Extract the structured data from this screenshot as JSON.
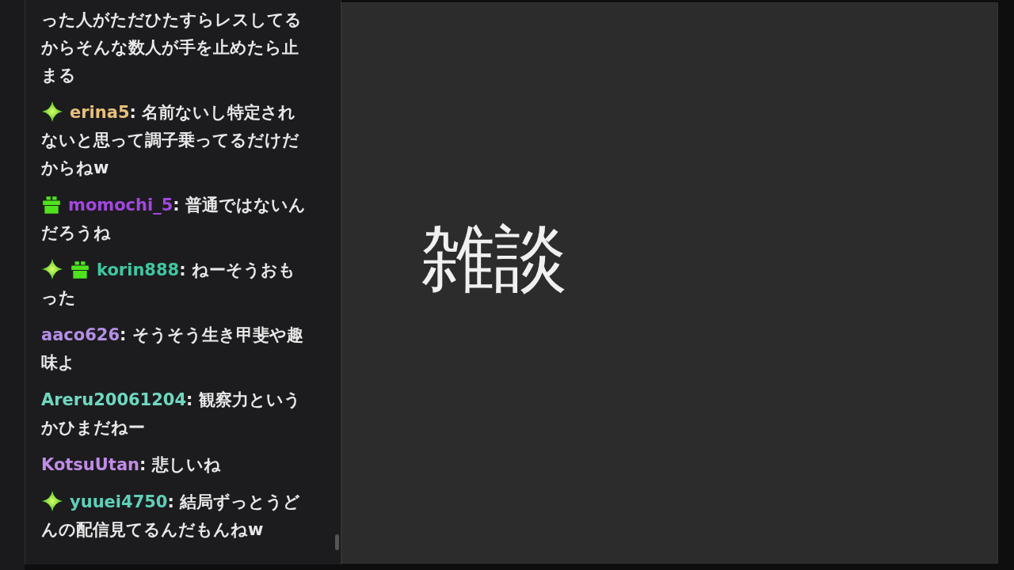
{
  "chat": {
    "messages": [
      {
        "text": "った人がただひたすらレスしてるからそんな数人が手を止めたら止まる"
      },
      {
        "badges": [
          {
            "kind": "sparkle"
          }
        ],
        "user": "erina5",
        "color": "#e8c07a",
        "text": ": 名前ないし特定されないと思って調子乗ってるだけだからねw"
      },
      {
        "badges": [
          {
            "kind": "gift"
          }
        ],
        "user": "momochi_5",
        "color": "#a447e0",
        "text": ": 普通ではないんだろうね"
      },
      {
        "badges": [
          {
            "kind": "sparkle"
          },
          {
            "kind": "gift"
          }
        ],
        "user": "korin888",
        "color": "#3fc7a0",
        "text": ": ねーそうおもった"
      },
      {
        "user": "aaco626",
        "color": "#b48ee6",
        "text": ": そうそう生き甲斐や趣味よ"
      },
      {
        "user": "Areru20061204",
        "color": "#6fd8bf",
        "text": ": 観察力というかひまだねー"
      },
      {
        "user": "KotsuUtan",
        "color": "#c08ce6",
        "text": ": 悲しいね"
      },
      {
        "badges": [
          {
            "kind": "sparkle"
          }
        ],
        "user": "yuuei4750",
        "color": "#5fd0b8",
        "text": ": 結局ずっとうどんの配信見てるんだもんねw"
      }
    ]
  },
  "stage": {
    "title": "雑談"
  }
}
